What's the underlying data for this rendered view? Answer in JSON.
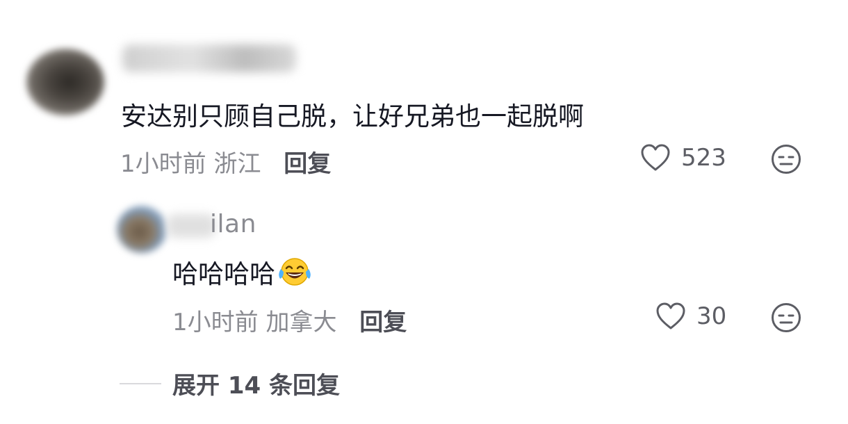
{
  "comments": [
    {
      "username_suffix": "",
      "text": "安达别只顾自己脱，让好兄弟也一起脱啊",
      "time": "1小时前",
      "location": "浙江",
      "reply_label": "回复",
      "likes": "523"
    }
  ],
  "reply": {
    "username_suffix": "ilan",
    "text": "哈哈哈哈",
    "emoji": "tears-of-joy-emoji",
    "time": "1小时前",
    "location": "加拿大",
    "reply_label": "回复",
    "likes": "30"
  },
  "expand": {
    "label": "展开 14 条回复"
  },
  "icons": {
    "like": "heart-outline-icon",
    "dislike": "neutral-face-icon"
  },
  "colors": {
    "primary_text": "#161823",
    "secondary_text": "#8a8b91",
    "action_text": "#4d4e56"
  }
}
